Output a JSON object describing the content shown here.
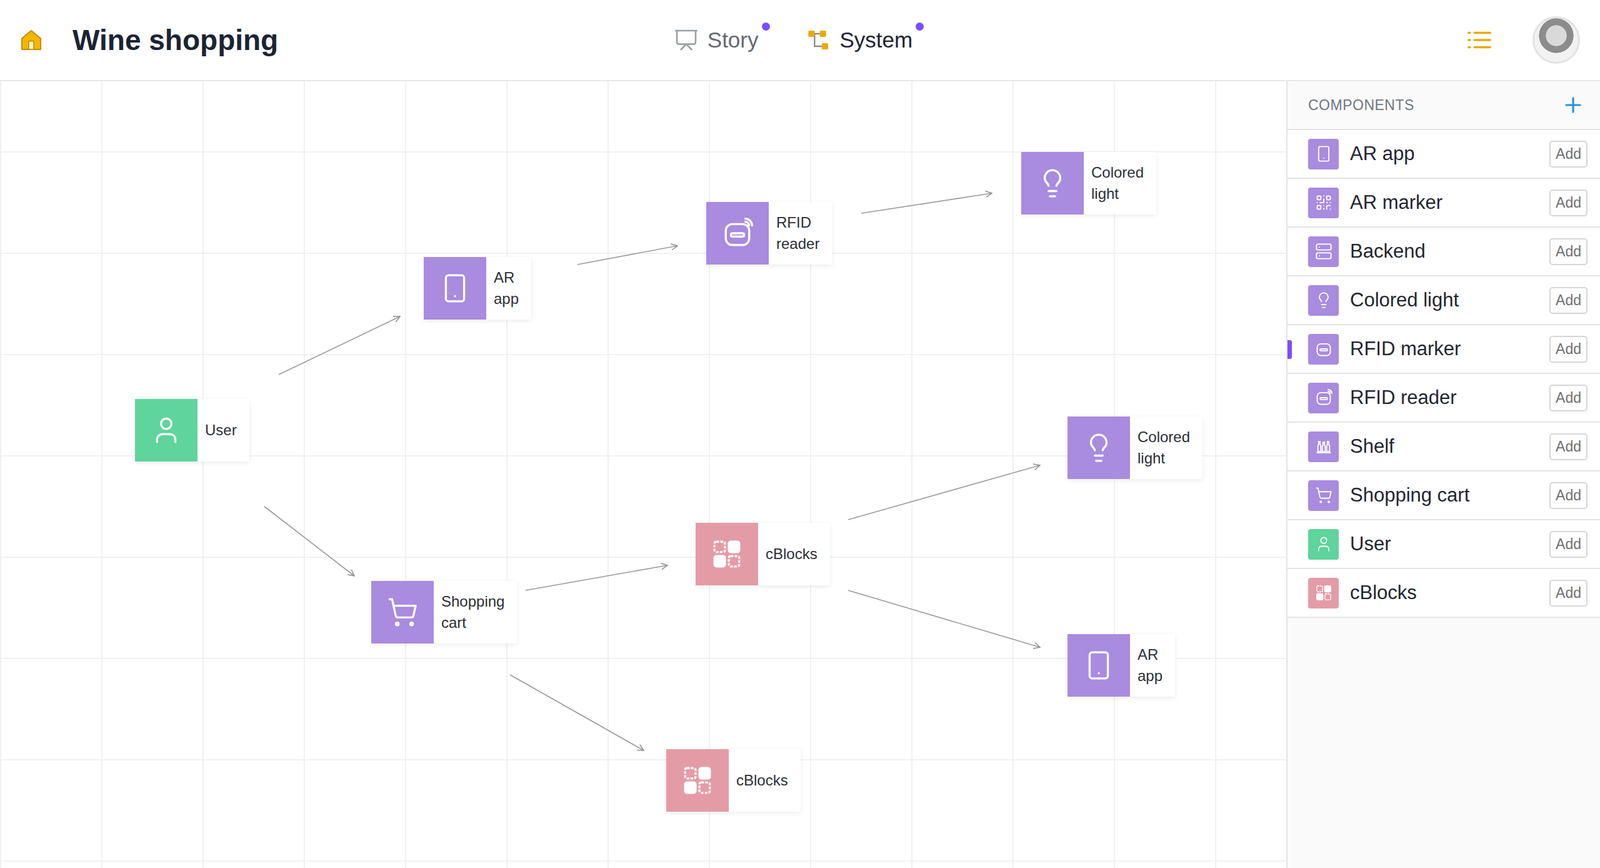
{
  "header": {
    "title": "Wine shopping"
  },
  "tabs": [
    {
      "label": "Story",
      "kind": "story",
      "selected": false,
      "dot": true
    },
    {
      "label": "System",
      "kind": "system",
      "selected": true,
      "dot": true
    }
  ],
  "sidebar": {
    "title": "COMPONENTS",
    "items": [
      {
        "label": "AR app",
        "kind": "phone",
        "color": "#a98bdf",
        "button": "Add",
        "selected": false
      },
      {
        "label": "AR marker",
        "kind": "qr",
        "color": "#a98bdf",
        "button": "Add",
        "selected": false
      },
      {
        "label": "Backend",
        "kind": "server",
        "color": "#a98bdf",
        "button": "Add",
        "selected": false
      },
      {
        "label": "Colored light",
        "kind": "bulb",
        "color": "#a98bdf",
        "button": "Add",
        "selected": false
      },
      {
        "label": "RFID marker",
        "kind": "rfid-card",
        "color": "#a98bdf",
        "button": "Add",
        "selected": true
      },
      {
        "label": "RFID reader",
        "kind": "rfid-reader",
        "color": "#a98bdf",
        "button": "Add",
        "selected": false
      },
      {
        "label": "Shelf",
        "kind": "shelf",
        "color": "#a98bdf",
        "button": "Add",
        "selected": false
      },
      {
        "label": "Shopping cart",
        "kind": "cart",
        "color": "#a98bdf",
        "button": "Add",
        "selected": false
      },
      {
        "label": "User",
        "kind": "user",
        "color": "#5fd49c",
        "button": "Add",
        "selected": false
      },
      {
        "label": "cBlocks",
        "kind": "blocks",
        "color": "#e39ca6",
        "button": "Add",
        "selected": false
      }
    ]
  },
  "canvas": {
    "nodes": [
      {
        "label": "User",
        "kind": "user",
        "color": "#5fd49c"
      },
      {
        "label": "AR app",
        "kind": "phone",
        "color": "#a98bdf"
      },
      {
        "label": "RFID reader",
        "kind": "rfid-reader",
        "color": "#a98bdf"
      },
      {
        "label": "Colored light",
        "kind": "bulb",
        "color": "#a98bdf"
      },
      {
        "label": "Shopping cart",
        "kind": "cart",
        "color": "#a98bdf"
      },
      {
        "label": "cBlocks",
        "kind": "blocks",
        "color": "#e39ca6"
      },
      {
        "label": "Colored light",
        "kind": "bulb",
        "color": "#a98bdf"
      },
      {
        "label": "AR app",
        "kind": "phone",
        "color": "#a98bdf"
      },
      {
        "label": "cBlocks",
        "kind": "blocks",
        "color": "#e39ca6"
      }
    ]
  }
}
